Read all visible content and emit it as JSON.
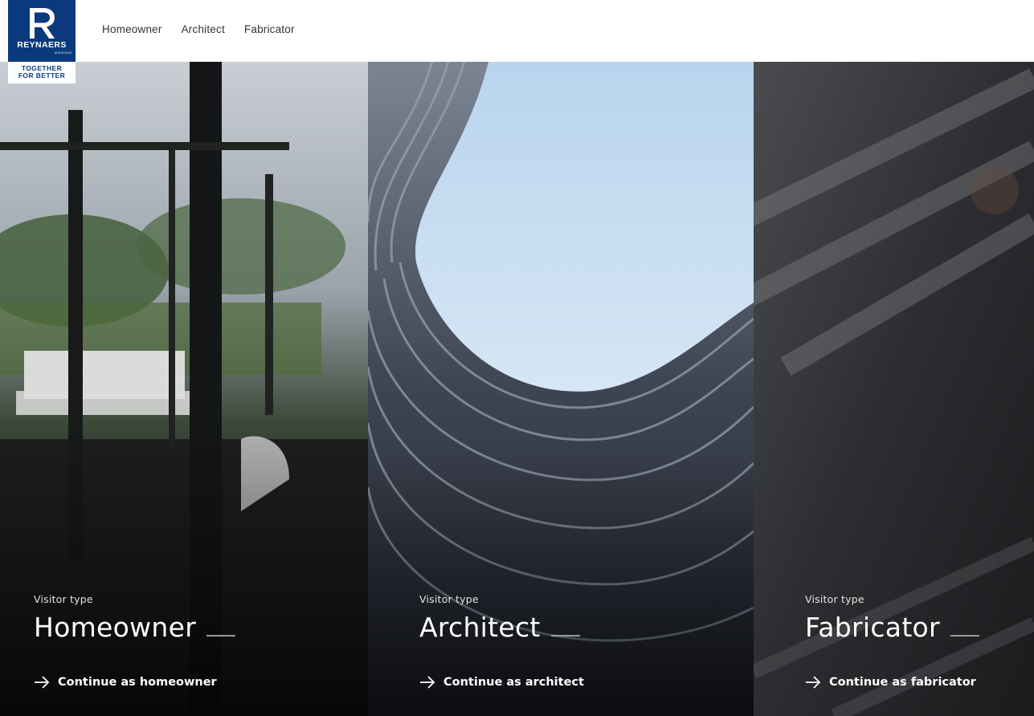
{
  "brand": {
    "name": "REYNAERS",
    "sub": "aluminium",
    "tagline_line1": "TOGETHER",
    "tagline_line2": "FOR BETTER",
    "color": "#0b3a7c"
  },
  "nav": {
    "items": [
      {
        "label": "Homeowner"
      },
      {
        "label": "Architect"
      },
      {
        "label": "Fabricator"
      }
    ]
  },
  "panels": [
    {
      "eyebrow": "Visitor type",
      "title": "Homeowner",
      "cta": "Continue as homeowner",
      "icon": "arrow-right-icon"
    },
    {
      "eyebrow": "Visitor type",
      "title": "Architect",
      "cta": "Continue as architect",
      "icon": "arrow-right-icon"
    },
    {
      "eyebrow": "Visitor type",
      "title": "Fabricator",
      "cta": "Continue as fabricator",
      "icon": "arrow-right-icon"
    }
  ]
}
